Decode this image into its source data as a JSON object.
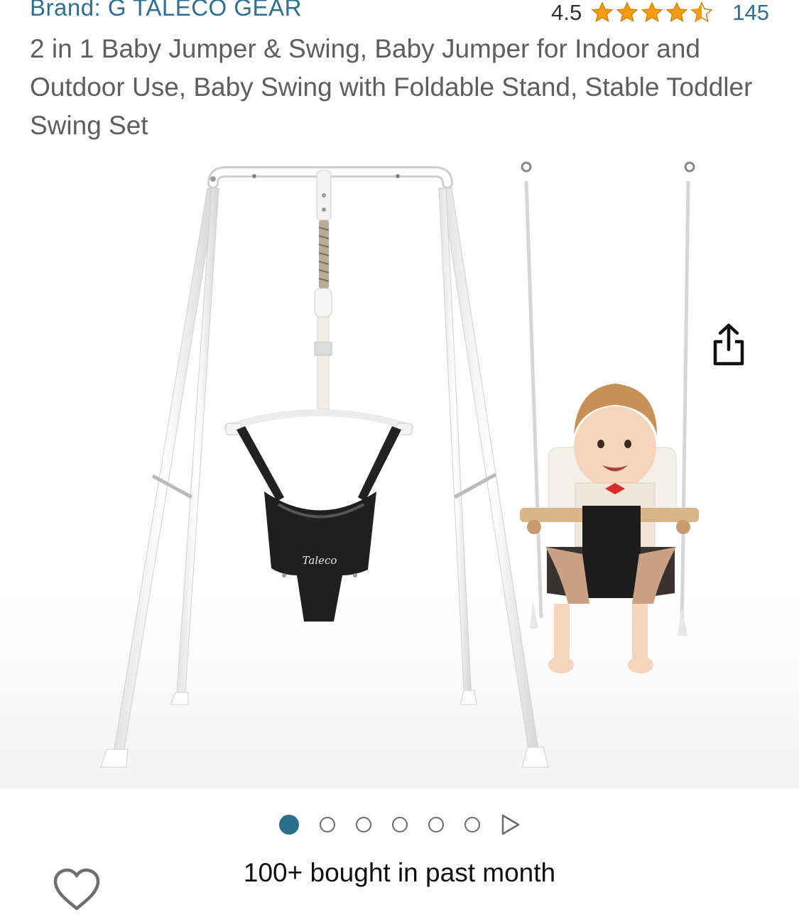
{
  "header": {
    "brand_link": "Brand: G TALECO GEAR",
    "rating_value": "4.5",
    "rating_stars": 4.5,
    "rating_count": "145",
    "star_color": "#f39c12"
  },
  "product": {
    "title": "2 in 1 Baby Jumper & Swing, Baby Jumper for Indoor and Outdoor Use, Baby Swing with Foldable Stand, Stable Toddler Swing Set",
    "seat_brand_text": "Taleco"
  },
  "gallery": {
    "image_count": 6,
    "active_index": 0,
    "icons": {
      "share": "share-icon",
      "wishlist": "heart-icon",
      "video": "play-icon"
    }
  },
  "social_proof": {
    "bought_text": "100+ bought in past month"
  },
  "colors": {
    "link": "#2f6f8f",
    "active_dot": "#2b6f8a"
  }
}
